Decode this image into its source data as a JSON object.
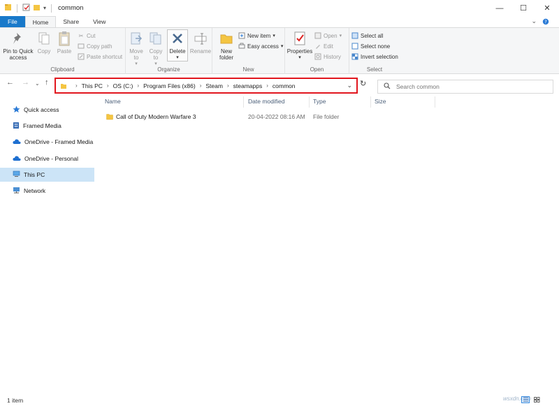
{
  "window": {
    "title": "common",
    "min": "—",
    "max": "☐",
    "close": "✕"
  },
  "ribbon_tabs": [
    {
      "label": "File"
    },
    {
      "label": "Home"
    },
    {
      "label": "Share"
    },
    {
      "label": "View"
    }
  ],
  "clipboard": {
    "label": "Clipboard",
    "pin_label": "Pin to Quick access",
    "copy_label": "Copy",
    "paste_label": "Paste",
    "cut_label": "Cut",
    "copy_path_label": "Copy path",
    "paste_shortcut_label": "Paste shortcut"
  },
  "organize": {
    "label": "Organize",
    "move_to_label": "Move to",
    "copy_to_label": "Copy to",
    "delete_label": "Delete",
    "rename_label": "Rename"
  },
  "new_group": {
    "label": "New",
    "new_folder_label": "New folder",
    "new_item_label": "New item",
    "easy_access_label": "Easy access"
  },
  "open_group": {
    "label": "Open",
    "properties_label": "Properties",
    "open_label": "Open",
    "edit_label": "Edit",
    "history_label": "History"
  },
  "select_group": {
    "label": "Select",
    "select_all_label": "Select all",
    "select_none_label": "Select none",
    "invert_label": "Invert selection"
  },
  "address": {
    "crumbs": [
      "This PC",
      "OS (C:)",
      "Program Files (x86)",
      "Steam",
      "steamapps",
      "common"
    ]
  },
  "search": {
    "placeholder": "Search common"
  },
  "sidebar": {
    "items": [
      {
        "label": "Quick access"
      },
      {
        "label": "Framed Media"
      },
      {
        "label": "OneDrive - Framed Media"
      },
      {
        "label": "OneDrive - Personal"
      },
      {
        "label": "This PC"
      },
      {
        "label": "Network"
      }
    ]
  },
  "columns": {
    "name": "Name",
    "date": "Date modified",
    "type": "Type",
    "size": "Size"
  },
  "files": [
    {
      "name": "Call of Duty Modern Warfare 3",
      "date": "20-04-2022 08:16 AM",
      "type": "File folder"
    }
  ],
  "status": {
    "count": "1 item"
  },
  "watermark": "wsxdn.com",
  "colors": {
    "accent": "#1979ca",
    "highlight_border": "#e1161e",
    "selected_bg": "#cce4f7",
    "folder": "#f4c542"
  }
}
